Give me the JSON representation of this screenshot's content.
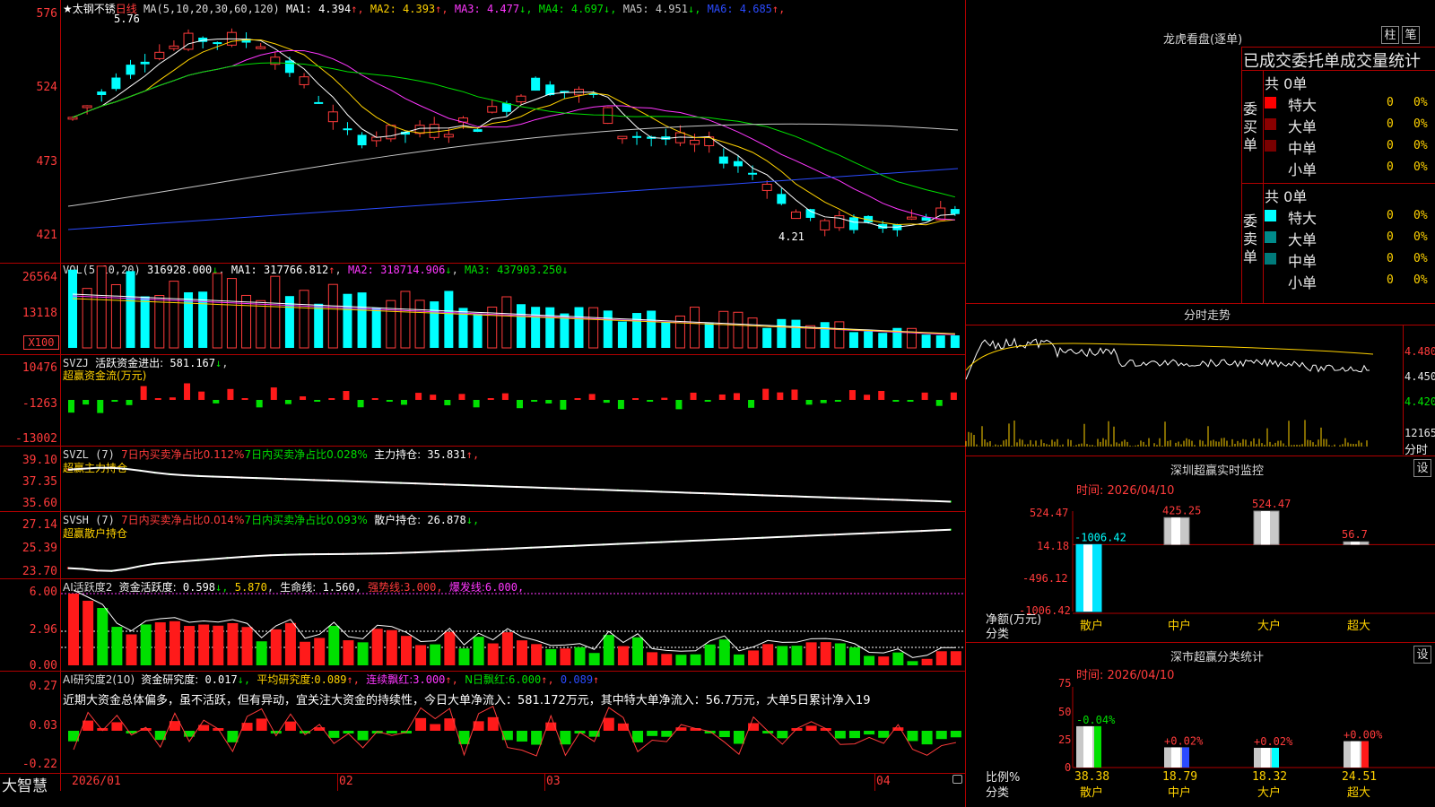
{
  "brand": "大智慧",
  "kline": {
    "star": "★",
    "stock_name": "太钢不锈",
    "period": "日线",
    "ma_params": "MA(5,10,20,30,60,120)",
    "ma": [
      {
        "label": "MA1:",
        "value": "4.394",
        "arrow": "↑",
        "color": "#ffffff"
      },
      {
        "label": "MA2:",
        "value": "4.393",
        "arrow": "↑",
        "color": "#ffd200"
      },
      {
        "label": "MA3:",
        "value": "4.477",
        "arrow": "↓",
        "color": "#ff37ff"
      },
      {
        "label": "MA4:",
        "value": "4.697",
        "arrow": "↓",
        "color": "#00e000"
      },
      {
        "label": "MA5:",
        "value": "4.951",
        "arrow": "↓",
        "color": "#c8c8c8"
      },
      {
        "label": "MA6:",
        "value": "4.685",
        "arrow": "↑",
        "color": "#2b4bff"
      }
    ],
    "yticks": [
      "576",
      "524",
      "473",
      "421"
    ],
    "high_label": "5.76",
    "low_label": "4.21"
  },
  "vol": {
    "name": "VOL(5,10,20)",
    "value": "316928.000",
    "arrow": "↓",
    "ma1_label": "MA1:",
    "ma1": "317766.812",
    "ma1_arrow": "↑",
    "ma2_label": "MA2:",
    "ma2": "318714.906",
    "ma2_arrow": "↓",
    "ma3_label": "MA3:",
    "ma3": "437903.250",
    "ma3_arrow": "↓",
    "yticks": [
      "26564",
      "13118"
    ],
    "unit": "X100"
  },
  "svzj": {
    "name": "SVZJ",
    "label": "活跃资金进出:",
    "value": "581.167",
    "arrow": "↓",
    "subtitle": "超赢资金流(万元)",
    "yticks": [
      "10476",
      "-1263",
      "-13002"
    ]
  },
  "svzl": {
    "name": "SVZL (7)",
    "t1": "7日内买卖净占比0.112%",
    "t2": "7日内买卖净占比0.028%",
    "t3": "主力持仓:",
    "v3": "35.831",
    "a3": "↑,",
    "subtitle": "超赢主力持仓",
    "yticks": [
      "39.10",
      "37.35",
      "35.60"
    ]
  },
  "svsh": {
    "name": "SVSH (7)",
    "t1": "7日内买卖净占比0.014%",
    "t2": "7日内买卖净占比0.093%",
    "t3": "散户持仓:",
    "v3": "26.878",
    "a3": "↓,",
    "subtitle": "超赢散户持仓",
    "yticks": [
      "27.14",
      "25.39",
      "23.70"
    ]
  },
  "ai_active": {
    "name": "AI活跃度2",
    "l1": "资金活跃度:",
    "v1": "0.598",
    "a1": "↓,",
    "v2": "5.870",
    "l3": "生命线:",
    "v3": "1.560,",
    "l4": "强势线:",
    "v4": "3.000,",
    "l5": "爆发线:",
    "v5": "6.000,",
    "yticks": [
      "6.00",
      "2.96",
      "0.00"
    ]
  },
  "ai_research": {
    "name": "AI研究度2(10)",
    "l1": "资金研究度:",
    "v1": "0.017",
    "a1": "↓,",
    "l2": "平均研究度:",
    "v2": "0.089",
    "a2": "↑,",
    "l3": "连续飘红:",
    "v3": "3.000",
    "a3": "↑,",
    "l4": "N日飘红:",
    "v4": "6.000",
    "a4": "↑,",
    "v5": "0.089",
    "a5": "↑",
    "comment": "近期大资金总体偏多，虽不活跃，但有异动，宜关注大资金的持续性，今日大单净流入：581.172万元，其中特大单净流入：56.7万元，大单5日累计净入19",
    "yticks": [
      "0.27",
      "0.03",
      "-0.22"
    ]
  },
  "xaxis": [
    "2026/01",
    "02",
    "03",
    "04"
  ],
  "longhu": {
    "title": "龙虎看盘(逐单)",
    "btn1": "柱",
    "btn2": "笔",
    "header": "已成交委托单成交量统计",
    "buy_side": "委买单",
    "sell_side": "委卖单",
    "buy_total": "共 0单",
    "sell_total": "共 0单",
    "buy_rows": [
      {
        "label": "特大",
        "count": "0",
        "pct": "0%",
        "color": "#ff0000"
      },
      {
        "label": "大单",
        "count": "0",
        "pct": "0%",
        "color": "#8b0000"
      },
      {
        "label": "中单",
        "count": "0",
        "pct": "0%",
        "color": "#7a0000"
      },
      {
        "label": "小单",
        "count": "0",
        "pct": "0%",
        "color": "#000000"
      }
    ],
    "sell_rows": [
      {
        "label": "特大",
        "count": "0",
        "pct": "0%",
        "color": "#00ffff"
      },
      {
        "label": "大单",
        "count": "0",
        "pct": "0%",
        "color": "#008b8b"
      },
      {
        "label": "中单",
        "count": "0",
        "pct": "0%",
        "color": "#007a7a"
      },
      {
        "label": "小单",
        "count": "0",
        "pct": "0%",
        "color": "#000000"
      }
    ]
  },
  "intraday": {
    "title": "分时走势",
    "yticks": [
      "4.480",
      "4.450",
      "4.420"
    ],
    "vol_label": "12165",
    "bottom_label": "分时"
  },
  "sz_monitor": {
    "title": "深圳超赢实时监控",
    "btn": "设",
    "time": "时间: 2026/04/10",
    "yticks": [
      "524.47",
      "14.18",
      "-496.12",
      "-1006.42"
    ],
    "ylabel1": "净额(万元)",
    "ylabel2": "分类",
    "chart_data": {
      "type": "bar",
      "categories": [
        "散户",
        "中户",
        "大户",
        "超大"
      ],
      "values": [
        -1006.42,
        425.25,
        524.47,
        56.7
      ],
      "value_labels": [
        "-1006.42",
        "425.25",
        "524.47",
        "56.7"
      ],
      "ylim": [
        -1006.42,
        524.47
      ],
      "xlabel": "分类",
      "ylabel": "净额(万元)"
    }
  },
  "sz_class": {
    "title": "深市超赢分类统计",
    "btn": "设",
    "time": "时间: 2026/04/10",
    "yticks": [
      "75",
      "50",
      "25",
      "0"
    ],
    "ylabel1": "比例%",
    "ylabel2": "分类",
    "chart_data": {
      "type": "bar",
      "categories": [
        "散户",
        "中户",
        "大户",
        "超大"
      ],
      "values": [
        38.38,
        18.79,
        18.32,
        24.51
      ],
      "value_labels": [
        "38.38",
        "18.79",
        "18.32",
        "24.51"
      ],
      "change_labels": [
        "-0.04%",
        "+0.02%",
        "+0.02%",
        "+0.00%"
      ],
      "ylim": [
        0,
        75
      ],
      "xlabel": "分类",
      "ylabel": "比例%"
    }
  }
}
